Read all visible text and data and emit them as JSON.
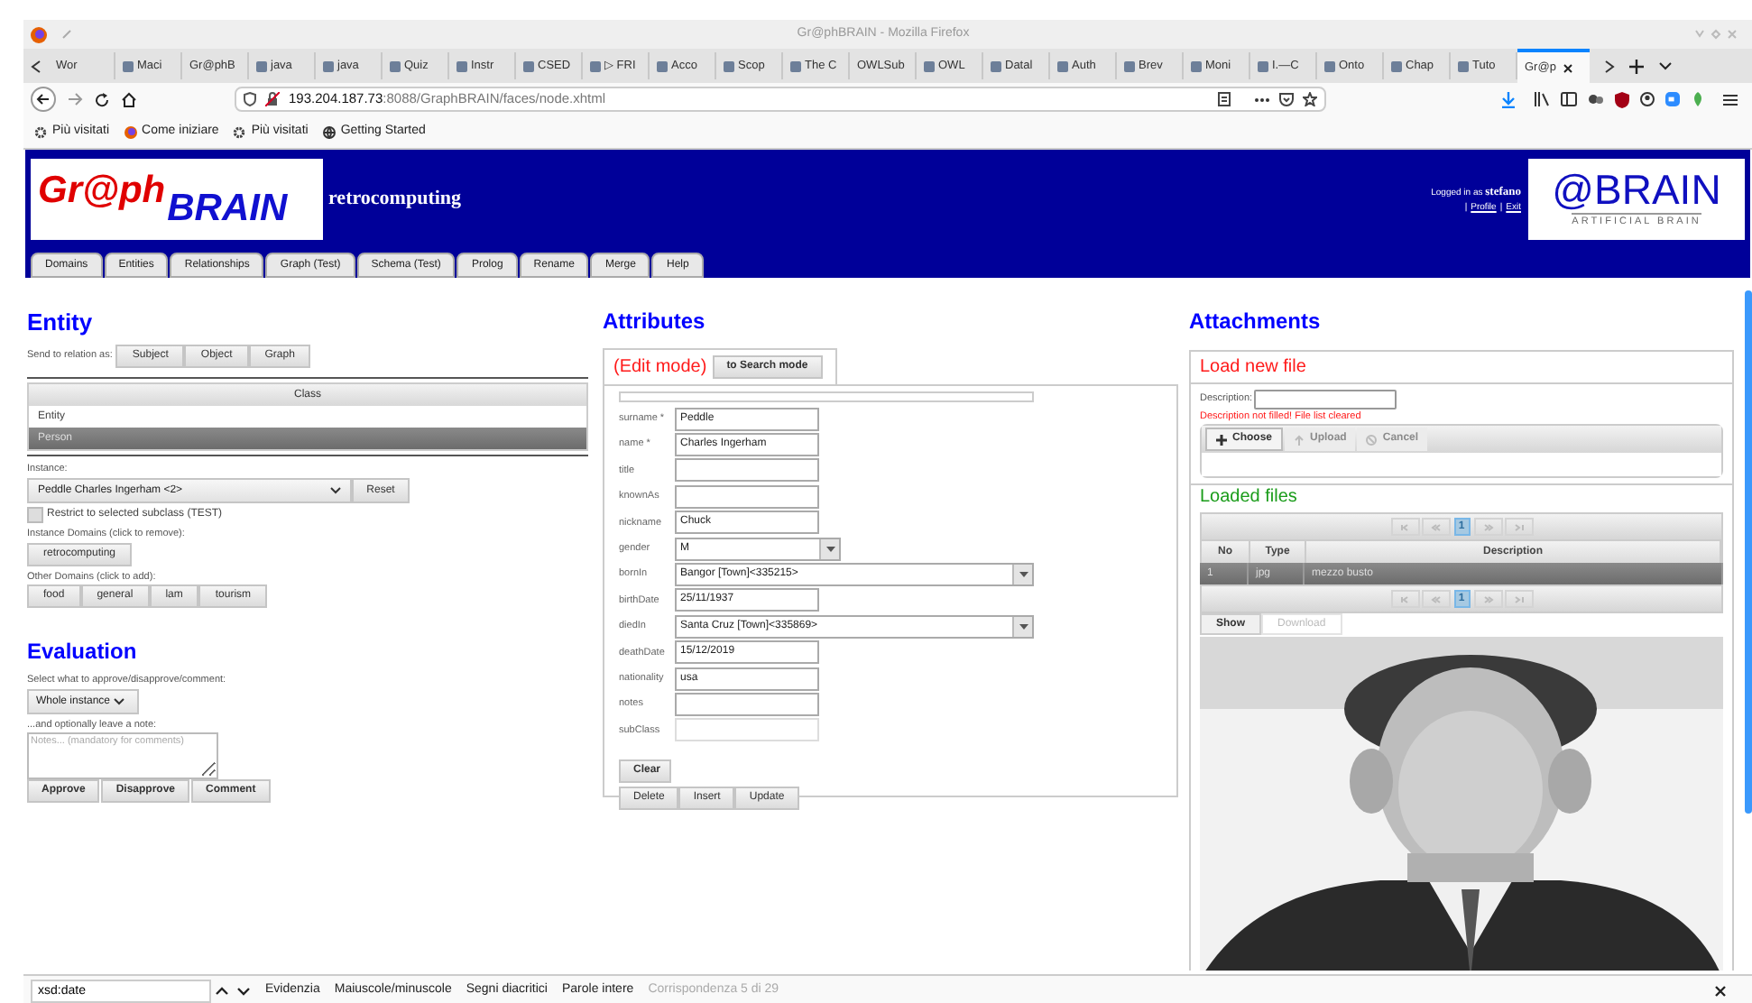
{
  "window": {
    "title": "Gr@phBRAIN - Mozilla Firefox"
  },
  "browser_tabs": [
    {
      "label": "Wor",
      "favicon": false,
      "selected": false
    },
    {
      "label": "Maci",
      "favicon": true,
      "selected": false
    },
    {
      "label": "Gr@phB",
      "favicon": false,
      "selected": false
    },
    {
      "label": "java",
      "favicon": true,
      "selected": false
    },
    {
      "label": "java",
      "favicon": true,
      "selected": false
    },
    {
      "label": "Quiz",
      "favicon": true,
      "selected": false
    },
    {
      "label": "Instr",
      "favicon": true,
      "selected": false
    },
    {
      "label": "CSED",
      "favicon": true,
      "selected": false
    },
    {
      "label": "▷ FRI",
      "favicon": true,
      "selected": false
    },
    {
      "label": "Acco",
      "favicon": true,
      "selected": false
    },
    {
      "label": "Scop",
      "favicon": true,
      "selected": false
    },
    {
      "label": "The C",
      "favicon": true,
      "selected": false
    },
    {
      "label": "OWLSub",
      "favicon": false,
      "selected": false
    },
    {
      "label": "OWL",
      "favicon": true,
      "selected": false
    },
    {
      "label": "Datal",
      "favicon": true,
      "selected": false
    },
    {
      "label": "Auth",
      "favicon": true,
      "selected": false
    },
    {
      "label": "Brev",
      "favicon": true,
      "selected": false
    },
    {
      "label": "Moni",
      "favicon": true,
      "selected": false
    },
    {
      "label": "I.—C",
      "favicon": true,
      "selected": false
    },
    {
      "label": "Onto",
      "favicon": true,
      "selected": false
    },
    {
      "label": "Chap",
      "favicon": true,
      "selected": false
    },
    {
      "label": "Tuto",
      "favicon": true,
      "selected": false
    },
    {
      "label": "Gr@p",
      "favicon": false,
      "selected": true
    }
  ],
  "address_bar": {
    "host": "193.204.187.73",
    "path": ":8088/GraphBRAIN/faces/node.xhtml"
  },
  "bookmarks": [
    "Più visitati",
    "Come iniziare",
    "Più visitati",
    "Getting Started"
  ],
  "header": {
    "logo_part_1": "Gr@ph",
    "logo_part_2": "BRAIN",
    "domain": "retrocomputing",
    "logged_in_label": "Logged in as",
    "user": "stefano",
    "links": [
      {
        "separator": "|",
        "label": "Profile"
      },
      {
        "separator": "|",
        "label": "Exit"
      }
    ],
    "right_logo": "@BRAIN",
    "right_logo_sub": "ARTIFICIAL BRAIN"
  },
  "nav_tabs": [
    "Domains",
    "Entities",
    "Relationships",
    "Graph (Test)",
    "Schema (Test)",
    "Prolog",
    "Rename",
    "Merge",
    "Help"
  ],
  "entity": {
    "title": "Entity",
    "send_label": "Send to relation as:",
    "send_buttons": [
      "Subject",
      "Object",
      "Graph"
    ],
    "class_table": {
      "column": "Class",
      "rows": [
        {
          "label": "Entity",
          "selected": false
        },
        {
          "label": "Person",
          "selected": true
        }
      ]
    },
    "instance_label": "Instance:",
    "instance": "Peddle Charles Ingerham <2>",
    "reset": "Reset",
    "restrict": {
      "label": "Restrict to selected subclass (TEST)",
      "checked": false
    },
    "instance_domains_label": "Instance Domains (click to remove):",
    "instance_domains": [
      "retrocomputing"
    ],
    "other_domains_label": "Other Domains (click to add):",
    "other_domains": [
      "food",
      "general",
      "lam",
      "tourism"
    ]
  },
  "evaluation": {
    "title": "Evaluation",
    "select_label": "Select what to approve/disapprove/comment:",
    "select": "Whole instance",
    "note_label": "...and optionally leave a note:",
    "note_placeholder": "Notes... (mandatory for comments)",
    "buttons": [
      "Approve",
      "Disapprove",
      "Comment"
    ]
  },
  "attributes": {
    "title": "Attributes",
    "mode": "(Edit mode)",
    "mode_button": "to Search mode",
    "fields": [
      {
        "label": "surname *",
        "value": "Peddle",
        "kind": "text"
      },
      {
        "label": "name *",
        "value": "Charles Ingerham",
        "kind": "text"
      },
      {
        "label": "title",
        "kind": "text"
      },
      {
        "label": "knownAs",
        "kind": "text"
      },
      {
        "label": "nickname",
        "value": "Chuck",
        "kind": "text"
      },
      {
        "label": "gender",
        "value": "M",
        "kind": "short_select"
      },
      {
        "label": "bornIn",
        "value": "Bangor [Town]<335215>",
        "kind": "select"
      },
      {
        "label": "birthDate",
        "value": "25/11/1937",
        "kind": "text"
      },
      {
        "label": "diedIn",
        "value": "Santa Cruz [Town]<335869>",
        "kind": "select"
      },
      {
        "label": "deathDate",
        "value": "15/12/2019",
        "kind": "text"
      },
      {
        "label": "nationality",
        "value": "usa",
        "kind": "text"
      },
      {
        "label": "notes",
        "kind": "text"
      },
      {
        "label": "subClass",
        "kind": "disabled"
      }
    ],
    "clear": "Clear",
    "buttons": [
      "Delete",
      "Insert",
      "Update"
    ]
  },
  "attachments": {
    "title": "Attachments",
    "load_title": "Load new file",
    "description_label": "Description:",
    "error": "Description not filled! File list cleared",
    "upload_buttons": [
      {
        "label": "Choose",
        "disabled": false
      },
      {
        "label": "Upload",
        "disabled": true
      },
      {
        "label": "Cancel",
        "disabled": true
      }
    ],
    "loaded_title": "Loaded files",
    "paginator_top": {
      "page": "1"
    },
    "columns": [
      "No",
      "Type",
      "Description"
    ],
    "rows": [
      {
        "cells": [
          "1",
          "jpg",
          "mezzo busto"
        ],
        "selected": true
      }
    ],
    "paginator_bottom": {
      "page": "1"
    },
    "view_tabs": [
      {
        "label": "Show",
        "selected": true
      },
      {
        "label": "Download",
        "selected": false
      }
    ],
    "preview": {
      "kind": "picture"
    }
  },
  "find_bar": {
    "query": "xsd:date",
    "options": [
      "Evidenzia",
      "Maiuscole/minuscole",
      "Segni diacritici",
      "Parole intere"
    ],
    "status": "Corrispondenza 5 di 29"
  }
}
